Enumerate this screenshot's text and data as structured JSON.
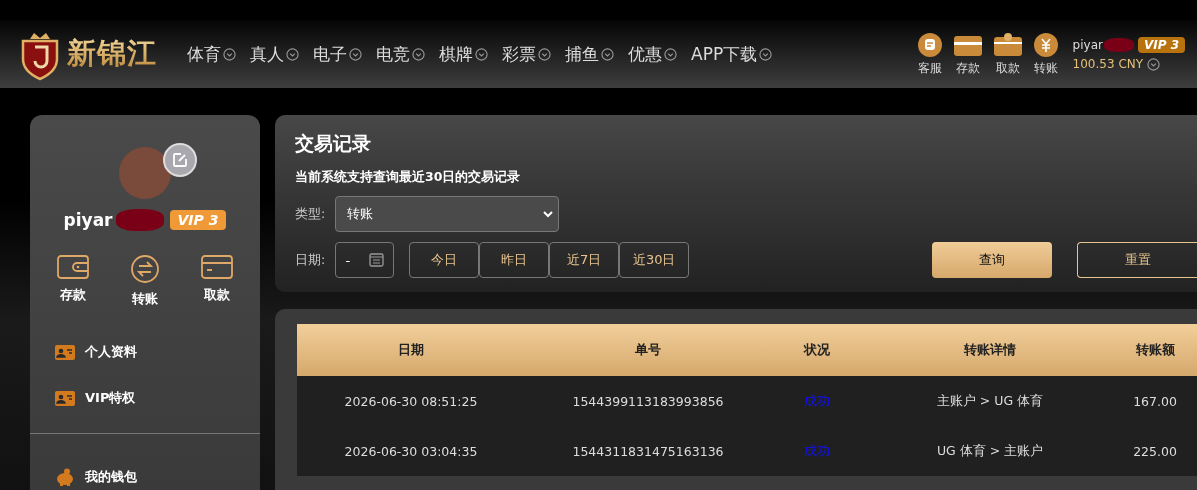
{
  "header": {
    "logo": "新锦江",
    "nav": [
      {
        "label": "体育"
      },
      {
        "label": "真人"
      },
      {
        "label": "电子"
      },
      {
        "label": "电竞"
      },
      {
        "label": "棋牌"
      },
      {
        "label": "彩票"
      },
      {
        "label": "捕鱼"
      },
      {
        "label": "优惠"
      },
      {
        "label": "APP下载"
      }
    ],
    "quick_actions": [
      {
        "kind": "chat",
        "label": "客服"
      },
      {
        "kind": "wallet",
        "label": "存款"
      },
      {
        "kind": "card",
        "label": "取款"
      },
      {
        "kind": "yuan",
        "label": "转账"
      }
    ],
    "user": {
      "name": "piyar",
      "vip": "VIP 3",
      "balance": "100.53 CNY"
    }
  },
  "sidebar": {
    "user": {
      "name": "piyar",
      "vip": "VIP 3"
    },
    "actions": [
      {
        "kind": "wallet",
        "label": "存款"
      },
      {
        "kind": "transfer",
        "label": "转账"
      },
      {
        "kind": "card",
        "label": "取款"
      }
    ],
    "menu": [
      {
        "kind": "id",
        "label": "个人资料"
      },
      {
        "kind": "id",
        "label": "VIP特权"
      }
    ],
    "wallet_menu": [
      {
        "kind": "piggy",
        "label": "我的钱包",
        "selected": false
      }
    ]
  },
  "filters": {
    "title": "交易记录",
    "note": "当前系统支持查询最近30日的交易记录",
    "type_label": "类型:",
    "type_value": "转账",
    "date_label": "日期:",
    "date_value": "-",
    "ranges": [
      {
        "label": "今日"
      },
      {
        "label": "昨日"
      },
      {
        "label": "近7日"
      },
      {
        "label": "近30日"
      }
    ],
    "query": "查询",
    "reset": "重置"
  },
  "table": {
    "columns": [
      "日期",
      "单号",
      "状况",
      "转账详情",
      "转账额"
    ],
    "rows": [
      {
        "cells": [
          "2026-06-30 08:51:25",
          "1544399113183993856",
          "成功",
          "主账户 > UG 体育",
          "167.00"
        ]
      },
      {
        "cells": [
          "2026-06-30 03:04:35",
          "1544311831475163136",
          "成功",
          "UG 体育 > 主账户",
          "225.00"
        ]
      }
    ]
  }
}
